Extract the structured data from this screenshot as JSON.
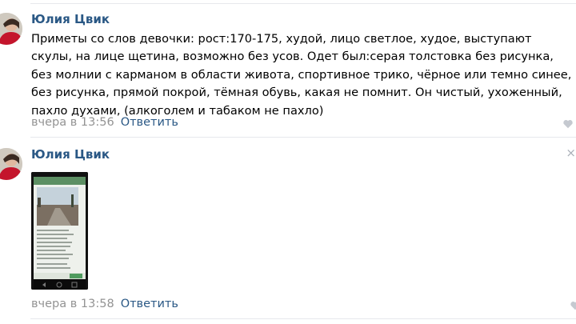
{
  "comments": [
    {
      "author": "Юлия Цвик",
      "text": "Приметы со слов девочки: рост:170-175, худой, лицо светлое, худое, выступают скулы, на лице щетина, возможно без усов. Одет был:серая толстовка без рисунка, без молнии с карманом в области живота, спортивное трико, чёрное или темно синее, без рисунка, прямой покрой, тёмная обувь, какая не помнит. Он чистый, ухоженный, пахло духами, (алкоголем и табаком не пахло)",
      "date": "вчера в 13:56",
      "reply_label": "Ответить"
    },
    {
      "author": "Юлия Цвик",
      "date": "вчера в 13:58",
      "reply_label": "Ответить",
      "close_glyph": "×",
      "attachment": "phone-screenshot"
    }
  ],
  "icons": {
    "like": "heart-icon",
    "close": "close-icon"
  },
  "colors": {
    "link": "#2a5885",
    "muted": "#939393",
    "divider": "#e7e8ec",
    "icon": "#c5c9d0"
  }
}
